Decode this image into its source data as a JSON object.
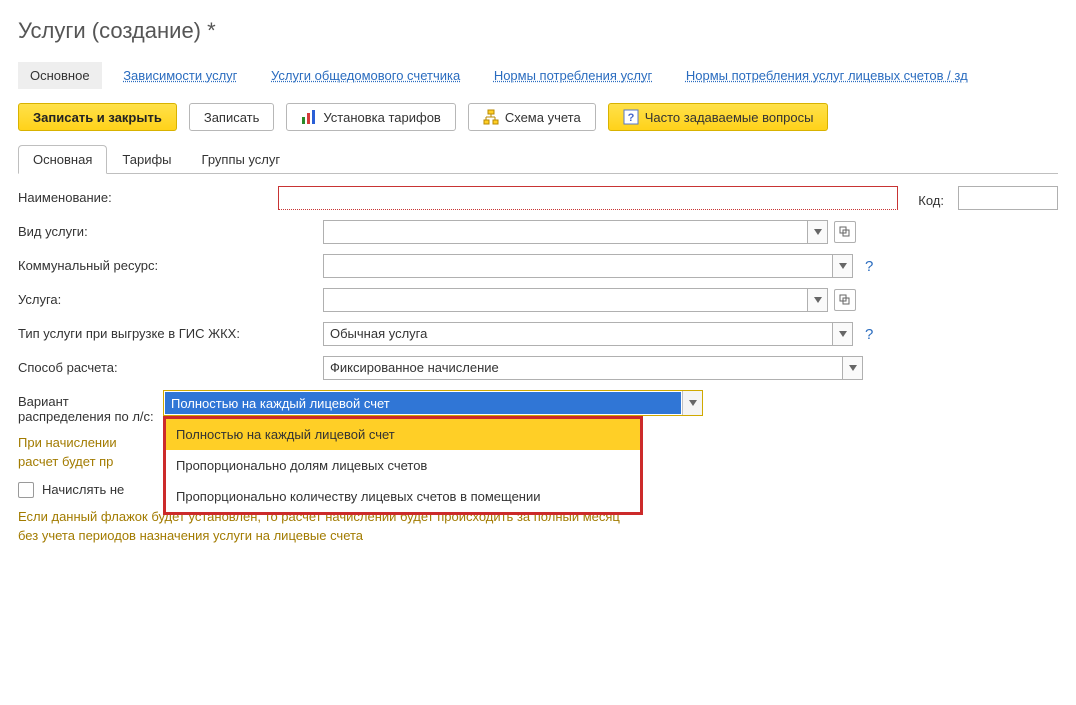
{
  "title": "Услуги (создание) *",
  "nav": {
    "main": "Основное",
    "deps": "Зависимости услуг",
    "meter": "Услуги общедомового счетчика",
    "norms": "Нормы потребления услуг",
    "norms_ls": "Нормы потребления услуг лицевых счетов / зд"
  },
  "toolbar": {
    "save_close": "Записать и закрыть",
    "save": "Записать",
    "tariffs": "Установка тарифов",
    "scheme": "Схема учета",
    "faq": "Часто задаваемые вопросы"
  },
  "tabs": {
    "main": "Основная",
    "tariffs": "Тарифы",
    "groups": "Группы услуг"
  },
  "form": {
    "name_label": "Наименование:",
    "code_label": "Код:",
    "kind_label": "Вид услуги:",
    "resource_label": "Коммунальный ресурс:",
    "service_label": "Услуга:",
    "gis_label": "Тип услуги при выгрузке в ГИС ЖКХ:",
    "gis_value": "Обычная услуга",
    "calc_label": "Способ расчета:",
    "calc_value": "Фиксированное начисление",
    "distrib_label": "Вариант распределения по л/с:",
    "distrib_value": "Полностью на каждый лицевой счет",
    "distrib_options": [
      "Полностью на каждый лицевой счет",
      "Пропорционально долям лицевых счетов",
      "Пропорционально количеству лицевых счетов в помещении"
    ],
    "hint1_a": "При начислении",
    "hint1_b": "расчет будет пр",
    "checkbox_label": "Начислять не",
    "hint2": "Если данный флажок будет установлен, то расчет начислений будет происходить за полный месяц без учета периодов назначения услуги на лицевые счета"
  }
}
